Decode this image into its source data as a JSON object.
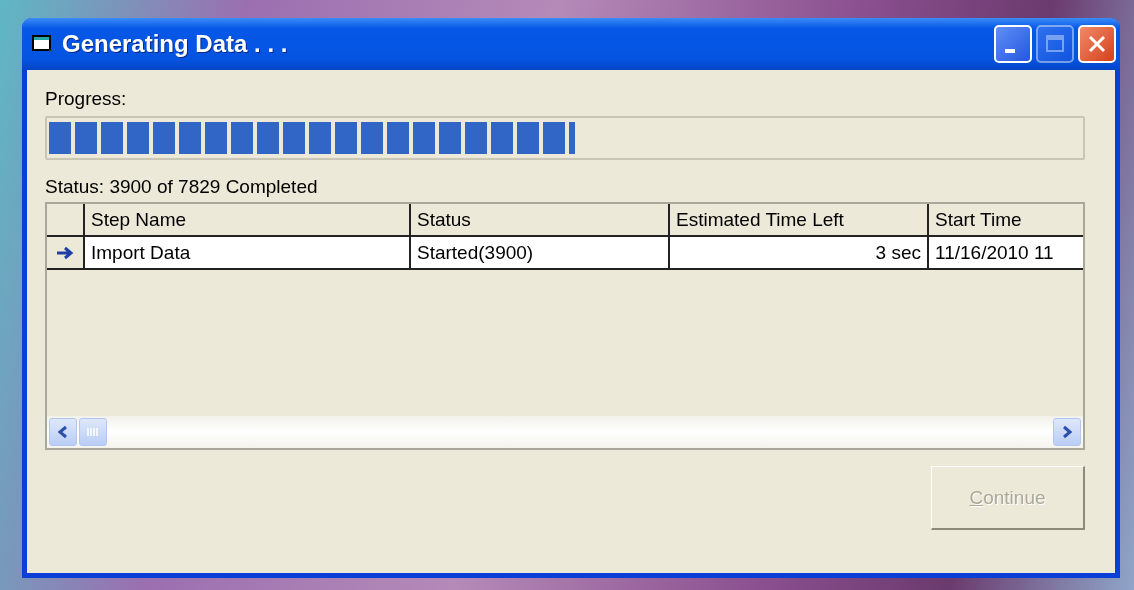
{
  "window": {
    "title": "Generating Data . . .",
    "title_buttons": [
      {
        "kind": "minimize",
        "disabled": false
      },
      {
        "kind": "maximize",
        "disabled": true
      },
      {
        "kind": "close",
        "disabled": false
      }
    ]
  },
  "progress": {
    "label": "Progress:",
    "level": 0.51
  },
  "status_text": "Status: 3900 of 7829 Completed",
  "grid": {
    "columns": [
      "Step Name",
      "Status",
      "Estimated Time Left",
      "Start Time"
    ],
    "rows": [
      {
        "current": true,
        "cells": [
          "Import Data",
          "Started(3900)",
          "3 sec",
          "11/16/2010 11"
        ]
      }
    ]
  },
  "continue_button": {
    "label": "Continue",
    "disabled": true
  }
}
